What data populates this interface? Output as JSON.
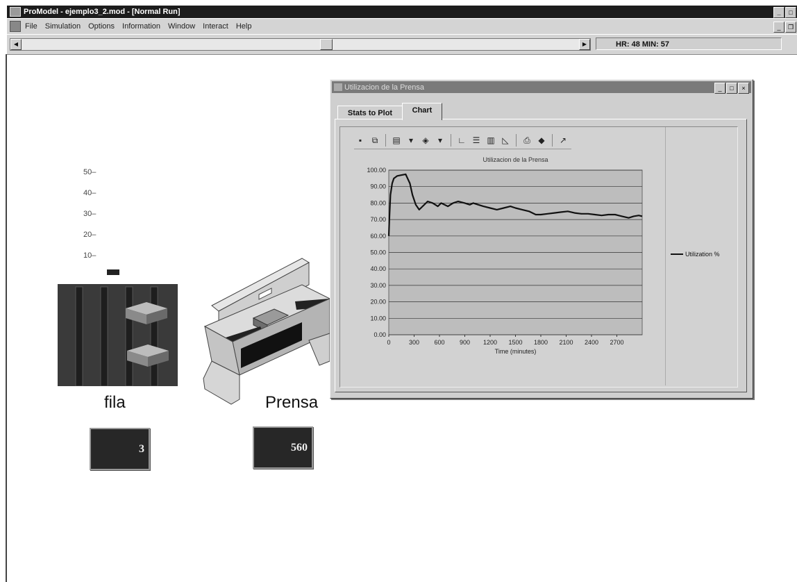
{
  "window": {
    "title": "ProModel - ejemplo3_2.mod - [Normal Run]",
    "menu": [
      "File",
      "Simulation",
      "Options",
      "Information",
      "Window",
      "Interact",
      "Help"
    ],
    "clock": "HR: 48 MIN: 57"
  },
  "simulation": {
    "meter_ticks": [
      "50–",
      "40–",
      "30–",
      "20–",
      "10–"
    ],
    "fila": {
      "label": "fila",
      "count": "3"
    },
    "prensa": {
      "label": "Prensa",
      "count": "560"
    }
  },
  "dialog": {
    "title": "Utilizacion de la Prensa",
    "tabs": [
      "Stats to Plot",
      "Chart"
    ],
    "active_tab": "Chart",
    "toolbar_icons": [
      "save-icon",
      "copy-icon",
      "gallery-icon",
      "color-icon",
      "vertical-grid-icon",
      "horizontal-grid-icon",
      "legend-icon",
      "axis-icon",
      "print-icon",
      "3d-icon",
      "tools-icon"
    ]
  },
  "chart_data": {
    "type": "line",
    "title": "Utilizacion de la Prensa",
    "xlabel": "Time (minutes)",
    "ylabel": "",
    "xlim": [
      0,
      3000
    ],
    "ylim": [
      0,
      100
    ],
    "x_ticks": [
      0,
      300,
      600,
      900,
      1200,
      1500,
      1800,
      2100,
      2400,
      2700
    ],
    "y_tick_labels": [
      "0.00",
      "10.00",
      "20.00",
      "30.00",
      "40.00",
      "50.00",
      "60.00",
      "70.00",
      "80.00",
      "90.00",
      "100.00"
    ],
    "grid": "horizontal",
    "legend_position": "right",
    "series": [
      {
        "name": "Utilization %",
        "color": "#111111",
        "x": [
          0,
          8,
          20,
          40,
          60,
          100,
          150,
          200,
          250,
          280,
          320,
          360,
          400,
          460,
          520,
          580,
          620,
          700,
          760,
          820,
          900,
          960,
          1000,
          1060,
          1120,
          1200,
          1280,
          1360,
          1440,
          1500,
          1580,
          1660,
          1740,
          1800,
          1880,
          1960,
          2040,
          2120,
          2200,
          2280,
          2360,
          2440,
          2520,
          2600,
          2680,
          2760,
          2840,
          2900,
          2960,
          3000
        ],
        "y": [
          60,
          72,
          85,
          92,
          95,
          96.5,
          97,
          97.5,
          92,
          85,
          79,
          76,
          78,
          81,
          80,
          78,
          80,
          78,
          80,
          81,
          80,
          79,
          80,
          79,
          78,
          77,
          76,
          77,
          78,
          77,
          76,
          75,
          73,
          73,
          73.5,
          74,
          74.5,
          75,
          74,
          73.5,
          73.5,
          73,
          72.5,
          73,
          73,
          72,
          71,
          72,
          72.5,
          72
        ]
      }
    ]
  },
  "colors": {
    "panel": "#cfcfcf",
    "plot_bg": "#bdbdbd",
    "counter_bg": "#272727"
  }
}
